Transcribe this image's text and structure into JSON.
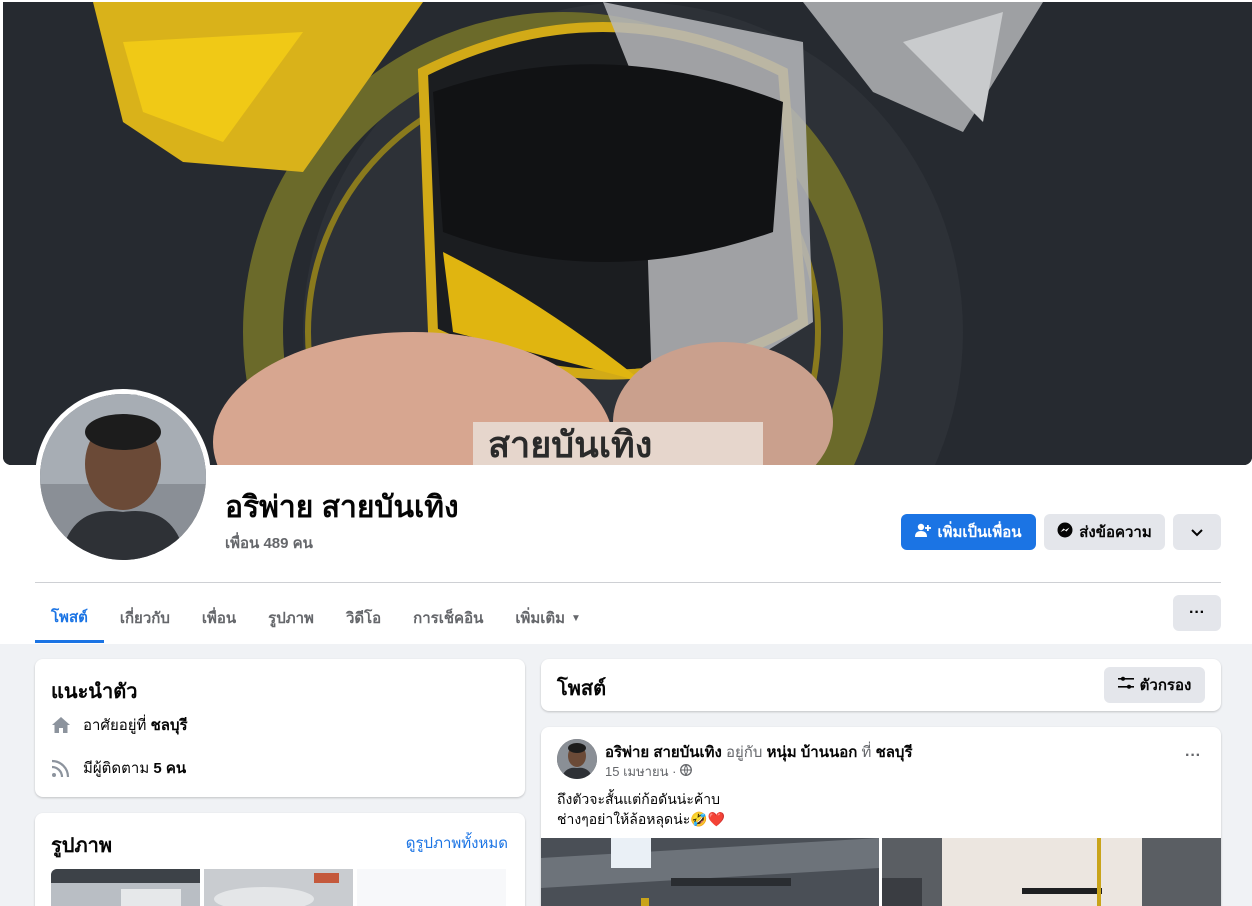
{
  "profile": {
    "name": "อริพ่าย สายบันเทิง",
    "friends": "เพื่อน 489 คน"
  },
  "actions": {
    "add_friend": "เพิ่มเป็นเพื่อน",
    "message": "ส่งข้อความ"
  },
  "tabs": [
    {
      "label": "โพสต์",
      "active": true
    },
    {
      "label": "เกี่ยวกับ"
    },
    {
      "label": "เพื่อน"
    },
    {
      "label": "รูปภาพ"
    },
    {
      "label": "วิดีโอ"
    },
    {
      "label": "การเช็คอิน"
    },
    {
      "label": "เพิ่มเติม"
    }
  ],
  "intro": {
    "title": "แนะนำตัว",
    "lives_prefix": "อาศัยอยู่ที่",
    "lives_city": "ชลบุรี",
    "followers_prefix": "มีผู้ติดตาม",
    "followers_count": "5 คน"
  },
  "photos": {
    "title": "รูปภาพ",
    "see_all": "ดูรูปภาพทั้งหมด"
  },
  "posts": {
    "title": "โพสต์",
    "filter": "ตัวกรอง"
  },
  "post": {
    "author": "อริพ่าย สายบันเทิง",
    "with_text": "อยู่กับ",
    "with_person": "หนุ่ม บ้านนอก",
    "at_text": "ที่",
    "place": "ชลบุรี",
    "date": "15 เมษายน ·",
    "line1": "ถึงตัวจะสั้นแต่ก้อดันน่ะค้าบ",
    "line2": "ช่างๆอย่าให้ล้อหลุดน่ะ🤣❤️"
  },
  "colors": {
    "accent": "#1b74e4",
    "secondary_button": "#e4e6eb",
    "page_bg": "#f0f2f5"
  }
}
